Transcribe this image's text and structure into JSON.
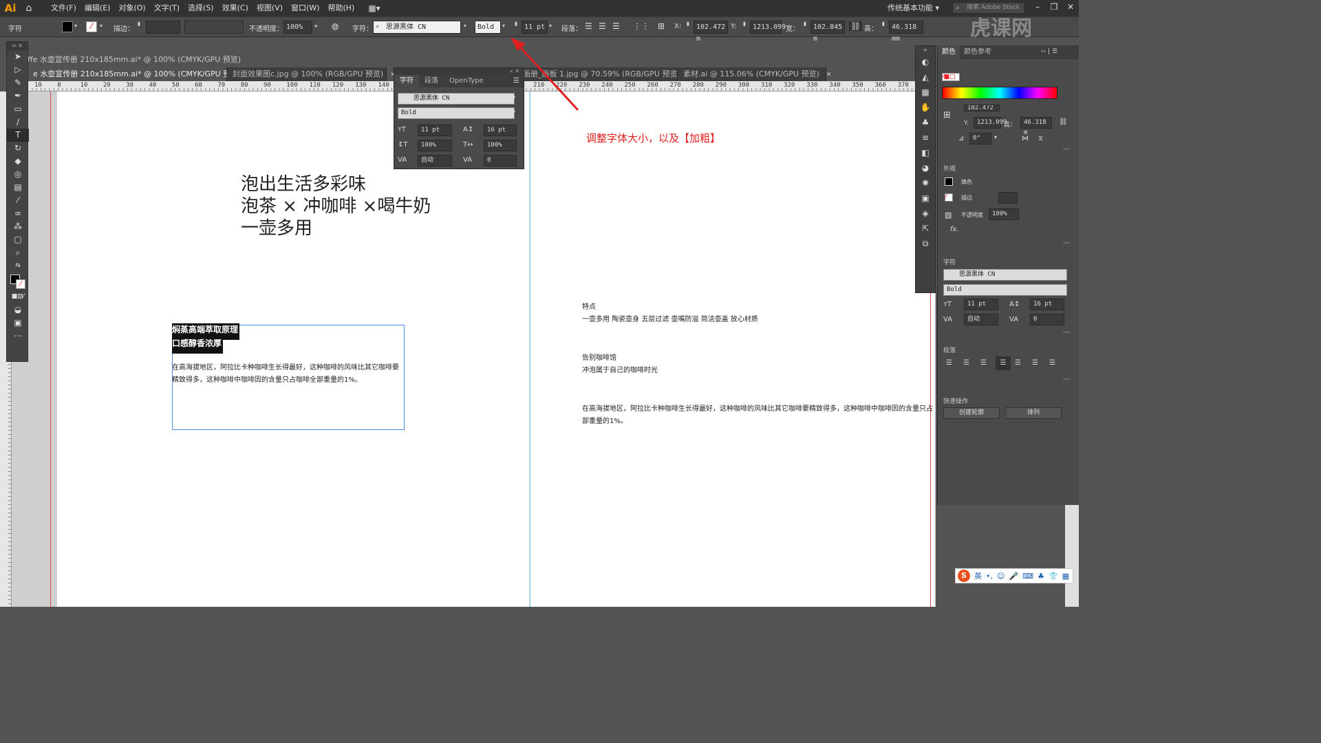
{
  "app": {
    "logo": "Ai"
  },
  "menu": [
    "文件(F)",
    "编辑(E)",
    "对象(O)",
    "文字(T)",
    "选择(S)",
    "效果(C)",
    "视图(V)",
    "窗口(W)",
    "帮助(H)"
  ],
  "workspace": "传统基本功能",
  "stock_search": {
    "placeholder": "搜索 Adobe Stock"
  },
  "control_bar": {
    "mode_label": "字符",
    "stroke_label": "描边：",
    "opacity_label": "不透明度：",
    "opacity_value": "100%",
    "char_label": "字符：",
    "font_family": "思源黑体 CN",
    "font_style": "Bold",
    "font_size": "11 pt",
    "para_label": "段落：",
    "x_label": "X:",
    "x_value": "102.472 m",
    "y_label": "Y:",
    "y_value": "1213.099",
    "w_label": "宽：",
    "w_value": "102.845 m",
    "h_label": "高：",
    "h_value": "46.318 mm"
  },
  "document_title": "ffe 水壶宣传册 210x185mm.ai* @ 100% (CMYK/GPU 预览)",
  "tabs": [
    {
      "label": "e 水壶宣传册 210x185mm.ai* @ 100% (CMYK/GPU 预览)",
      "active": true
    },
    {
      "label": "封面效果图c.jpg @ 100% (RGB/GPU 预览)",
      "active": false
    },
    {
      "label": "画册_画板 1.jpg @ 70.59% (RGB/GPU 预览)",
      "active": false
    },
    {
      "label": "素材.ai @ 115.06% (CMYK/GPU 预览)",
      "active": false
    }
  ],
  "ruler_top": [
    "10",
    "0",
    "10",
    "20",
    "30",
    "40",
    "50",
    "60",
    "70",
    "80",
    "90",
    "100",
    "110",
    "120",
    "130",
    "140",
    "210",
    "220",
    "230",
    "240",
    "250",
    "260",
    "270",
    "280",
    "290",
    "300",
    "310",
    "320",
    "330",
    "340",
    "350",
    "360",
    "370"
  ],
  "artboard_left": {
    "headline": [
      "泡出生活多彩味",
      "泡茶 × 冲咖啡 ×喝牛奶",
      "一壶多用"
    ],
    "selected_lines": [
      "焖蒸高端萃取原理",
      "口感醇香浓厚"
    ],
    "body": "在高海拔地区，阿拉比卡种咖啡生长得最好，这种咖啡的风味比其它咖啡要精致得多，这种咖啡中咖啡因的含量只占咖啡全部重量的1%。"
  },
  "artboard_right": {
    "annotation": "调整字体大小，以及【加粗】",
    "features_title": "特点",
    "features_list": "一壶多用 陶瓷壶身 五层过滤 壶嘴防溢 简洁壶盖 放心材质",
    "cafe_title": "告别咖啡馆",
    "cafe_sub": "冲泡属于自己的咖啡时光",
    "body_line1": "在高海拔地区，阿拉比卡种咖啡生长得最好，这种咖啡的风味比其它咖啡要精致得多，这种咖啡中咖啡因的含量只占",
    "body_line2": "部重量的1%。"
  },
  "char_panel": {
    "tabs": [
      "字符",
      "段落",
      "OpenType"
    ],
    "font_family": "思源黑体 CN",
    "font_style": "Bold",
    "size": "11 pt",
    "leading": "16 pt",
    "v_scale": "100%",
    "h_scale": "100%",
    "kerning": "自动",
    "tracking": "0"
  },
  "props_panel": {
    "tabs": [
      "颜色",
      "颜色参考"
    ],
    "x_value": "102.472",
    "y_label": "Y:",
    "y_value": "1213.099",
    "h_label": "高：",
    "h_value": "46.318 m",
    "angle": "0°",
    "appearance_title": "外观",
    "fill_label": "填色",
    "stroke_label": "描边",
    "opacity_label": "不透明度",
    "opacity_value": "100%",
    "fx": "fx.",
    "char_title": "字符",
    "font_family": "思源黑体 CN",
    "font_style": "Bold",
    "size": "11 pt",
    "leading": "16 pt",
    "kerning": "自动",
    "tracking": "0",
    "para_title": "段落",
    "quick_title": "快速操作",
    "btn_outline": "创建轮廓",
    "btn_arrange": "排列"
  },
  "ime": {
    "mode": "英"
  },
  "watermark": "虎课网",
  "colors": {
    "accent": "#ff9a00",
    "annotation": "#e02020",
    "selection": "#4a8ae8"
  }
}
